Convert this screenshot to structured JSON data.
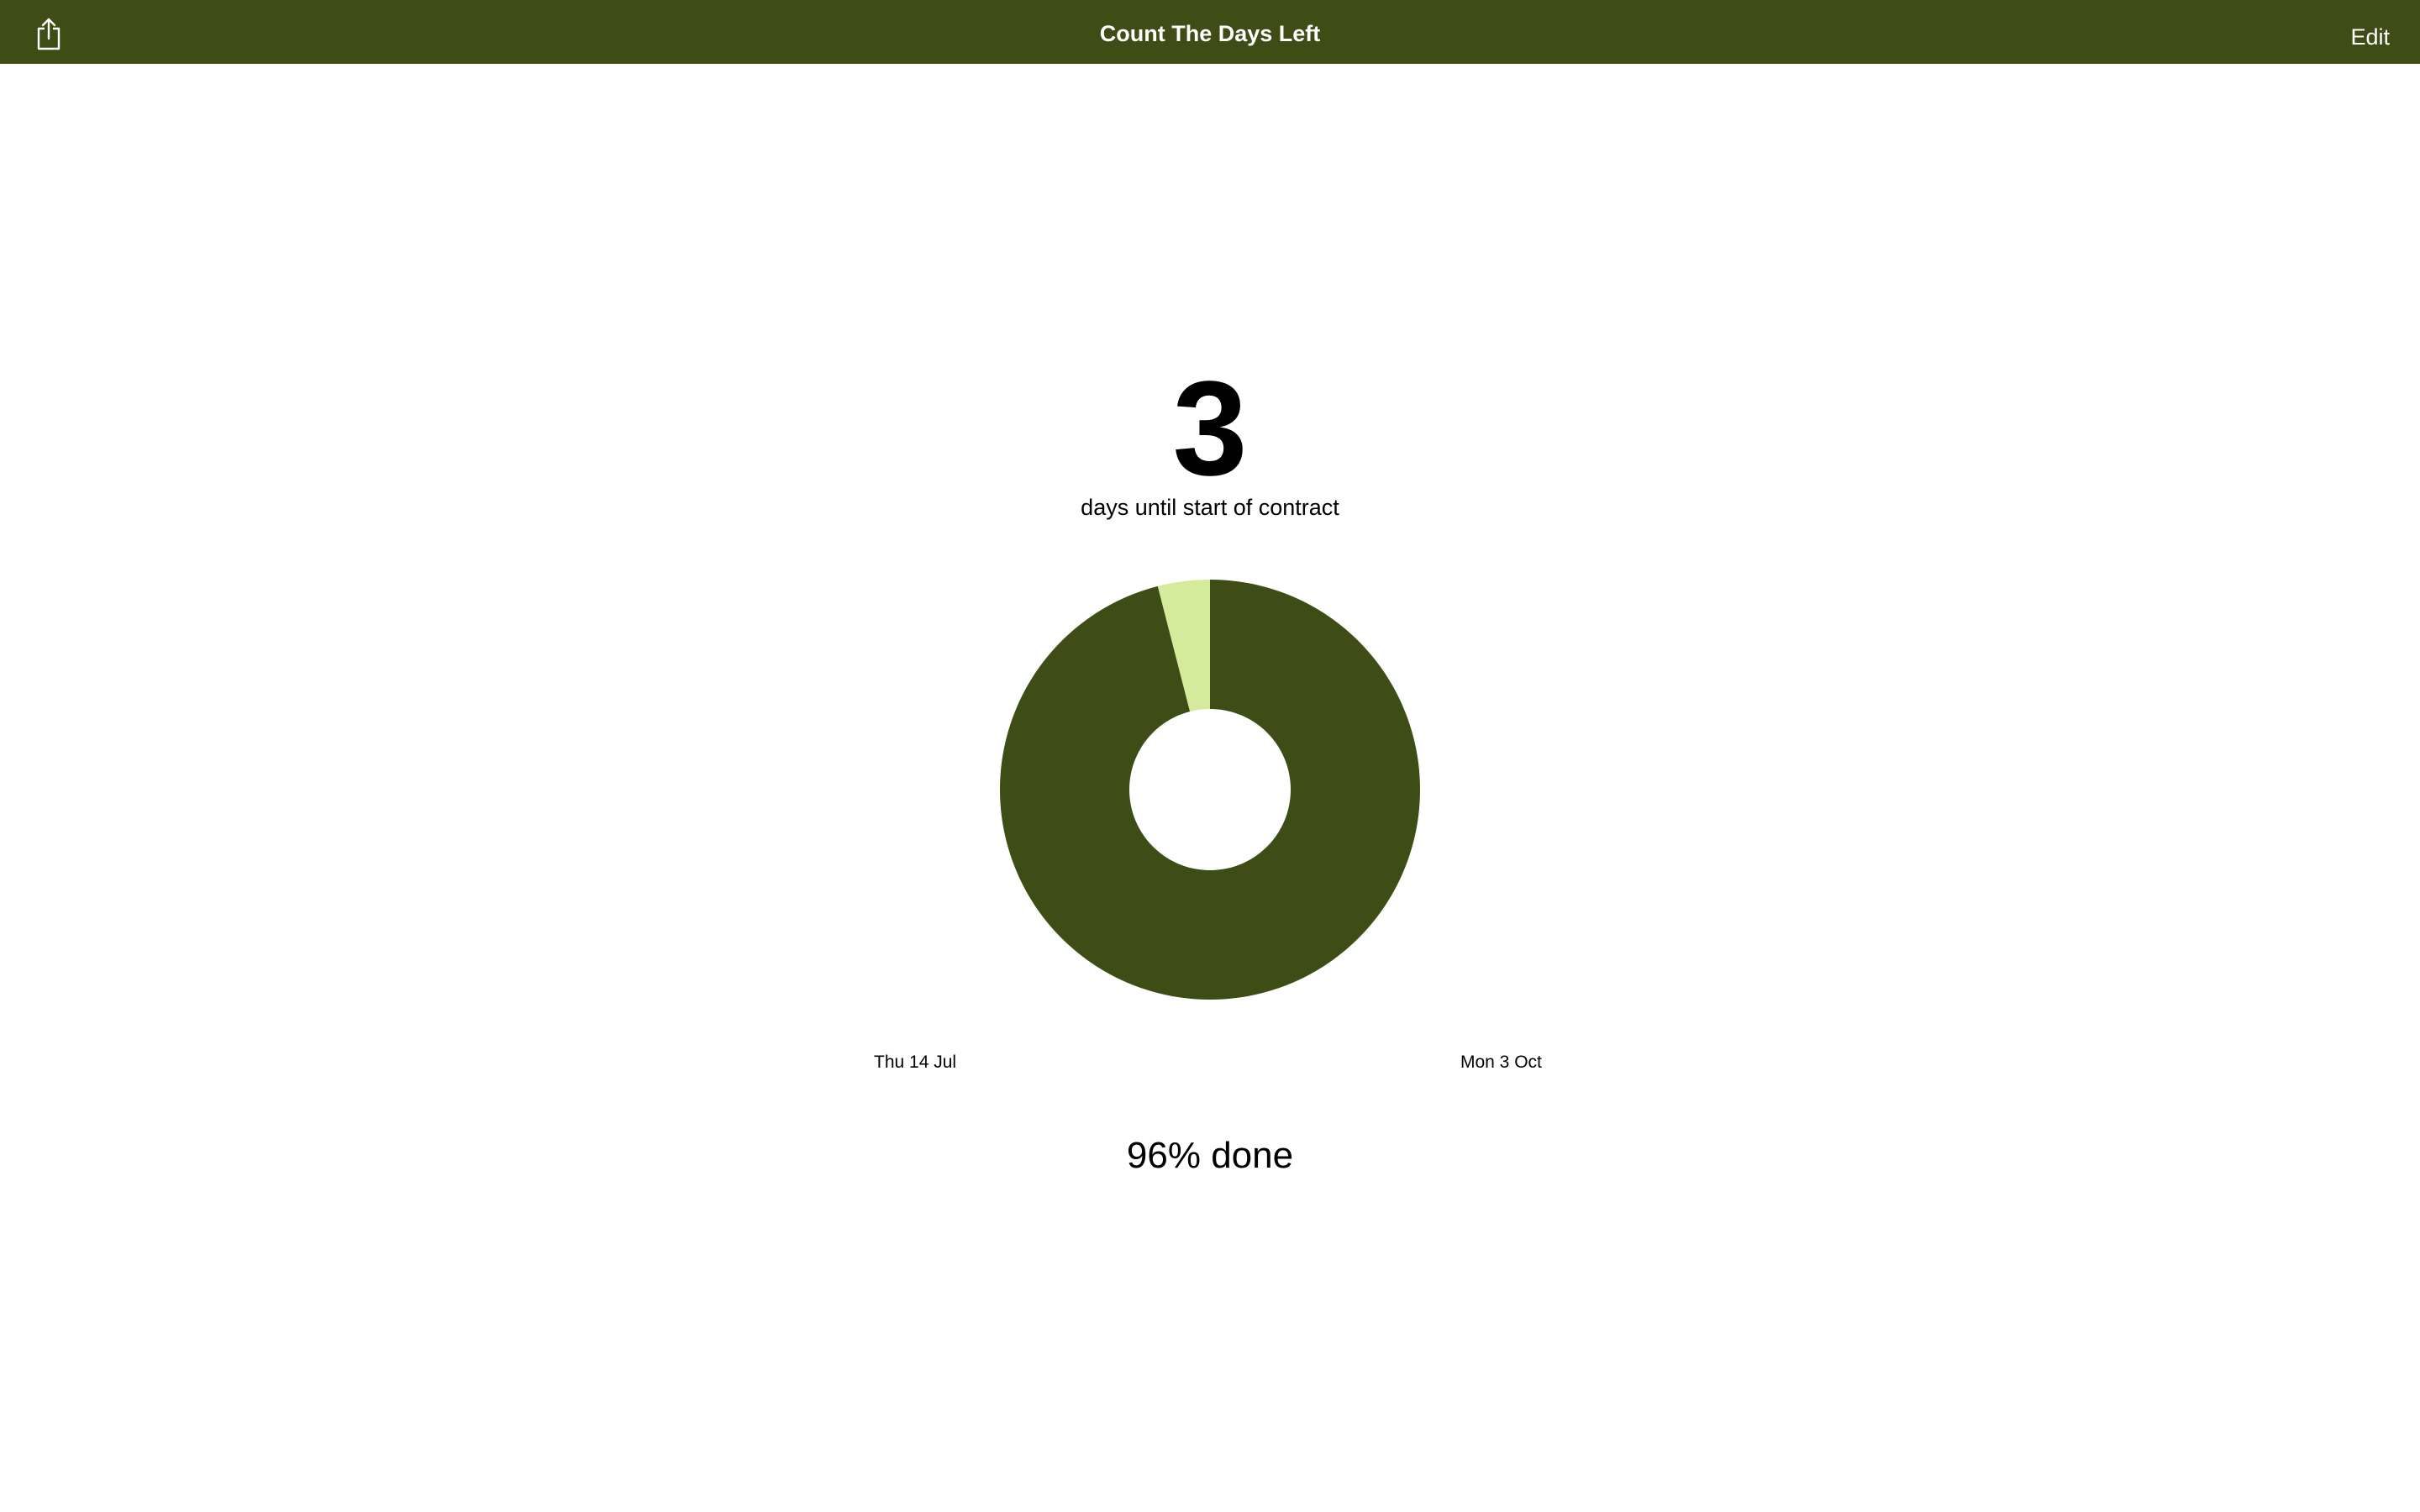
{
  "navbar": {
    "title": "Count The Days Left",
    "share_icon": "share-icon",
    "edit_label": "Edit",
    "background_color": "#3d4d15"
  },
  "countdown": {
    "days_remaining": "3",
    "caption": "days until start of contract",
    "start_date": "Thu 14 Jul",
    "end_date": "Mon 3 Oct",
    "progress_label": "96% done"
  },
  "chart_data": {
    "type": "pie",
    "values": [
      96,
      4
    ],
    "colors": [
      "#3d4d15",
      "#d4eb9c"
    ]
  }
}
